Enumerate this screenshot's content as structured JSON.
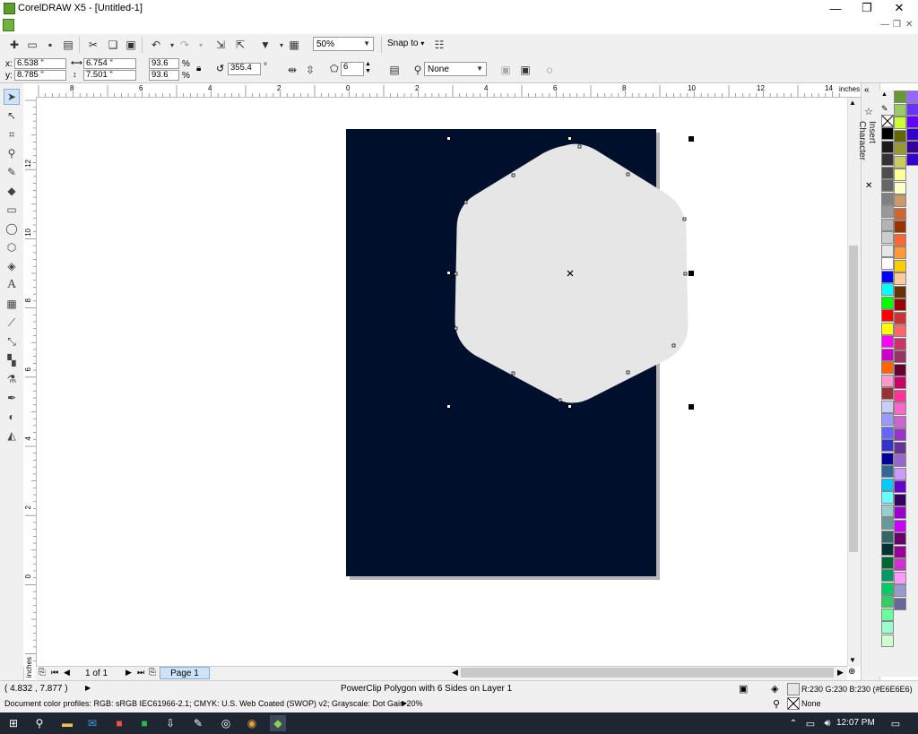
{
  "window": {
    "title": "CorelDRAW X5 - [Untitled-1]",
    "min_glyph": "—",
    "max_glyph": "❐",
    "close_glyph": "✕"
  },
  "toolbar": {
    "zoom_value": "50%",
    "snap_label": "Snap to"
  },
  "properties": {
    "x_label": "x:",
    "x_value": "6.538 \"",
    "y_label": "y:",
    "y_value": "8.785 \"",
    "w_value": "6.754 \"",
    "h_value": "7.501 \"",
    "scale_x": "93.6",
    "scale_y": "93.6",
    "pct": "%",
    "rotation": "355.4",
    "deg": "°",
    "sides": "6",
    "outline": "None"
  },
  "ruler": {
    "unit": "inches",
    "h_ticks": [
      "8",
      "6",
      "4",
      "2",
      "0",
      "2",
      "4",
      "6",
      "8",
      "10",
      "12",
      "14"
    ],
    "v_ticks": [
      "12",
      "10",
      "8",
      "6",
      "4",
      "2",
      "0"
    ]
  },
  "docker": {
    "title": "Insert Character"
  },
  "palette": {
    "col1": [
      "#000000",
      "#1a1a1a",
      "#333333",
      "#4d4d4d",
      "#666666",
      "#808080",
      "#999999",
      "#b3b3b3",
      "#cccccc",
      "#e6e6e6",
      "#ffffff",
      "#0000ff",
      "#00ffff",
      "#00ff00",
      "#ff0000",
      "#ffff00",
      "#ff00ff",
      "#cc00cc",
      "#ff6600",
      "#ff99cc",
      "#993333",
      "#ccccff",
      "#9999ff",
      "#6666ff",
      "#3333cc",
      "#000099",
      "#336699",
      "#00ccff",
      "#66ffff",
      "#99cccc",
      "#669999",
      "#336666",
      "#003333",
      "#006633",
      "#009966",
      "#00cc66",
      "#33cc66",
      "#66ff99",
      "#99ffcc",
      "#ccffcc"
    ],
    "col2": [
      "#669933",
      "#99cc66",
      "#ccff33",
      "#666600",
      "#999933",
      "#cccc66",
      "#ffff99",
      "#ffffcc",
      "#cc9966",
      "#cc6633",
      "#993300",
      "#ff6633",
      "#ff9933",
      "#ffcc00",
      "#ffcc99",
      "#663300",
      "#990000",
      "#cc3333",
      "#ff6666",
      "#cc3366",
      "#993366",
      "#660033",
      "#cc0066",
      "#ff3399",
      "#ff66cc",
      "#cc66cc",
      "#9933cc",
      "#663399",
      "#9966cc",
      "#cc99ff",
      "#6600cc",
      "#330066",
      "#9900cc",
      "#cc00ff",
      "#660066",
      "#990099",
      "#cc33cc",
      "#ff99ff",
      "#9999cc",
      "#666699"
    ]
  },
  "pagebar": {
    "page_count": "1 of 1",
    "page_tab": "Page 1"
  },
  "status": {
    "coords": "( 4.832 , 7.877 )",
    "object_info": "PowerClip Polygon with 6 Sides on Layer 1",
    "fill_info": "R:230 G:230 B:230 (#E6E6E6)",
    "outline_info": "None",
    "color_profile": "Document color profiles: RGB: sRGB IEC61966-2.1; CMYK: U.S. Web Coated (SWOP) v2; Grayscale: Dot Gain 20%"
  },
  "taskbar": {
    "time": "12:07 PM"
  },
  "colors": {
    "page_bg": "#000f2c",
    "shape_fill": "#e6e6e6",
    "accent": "#5b9e2c"
  }
}
